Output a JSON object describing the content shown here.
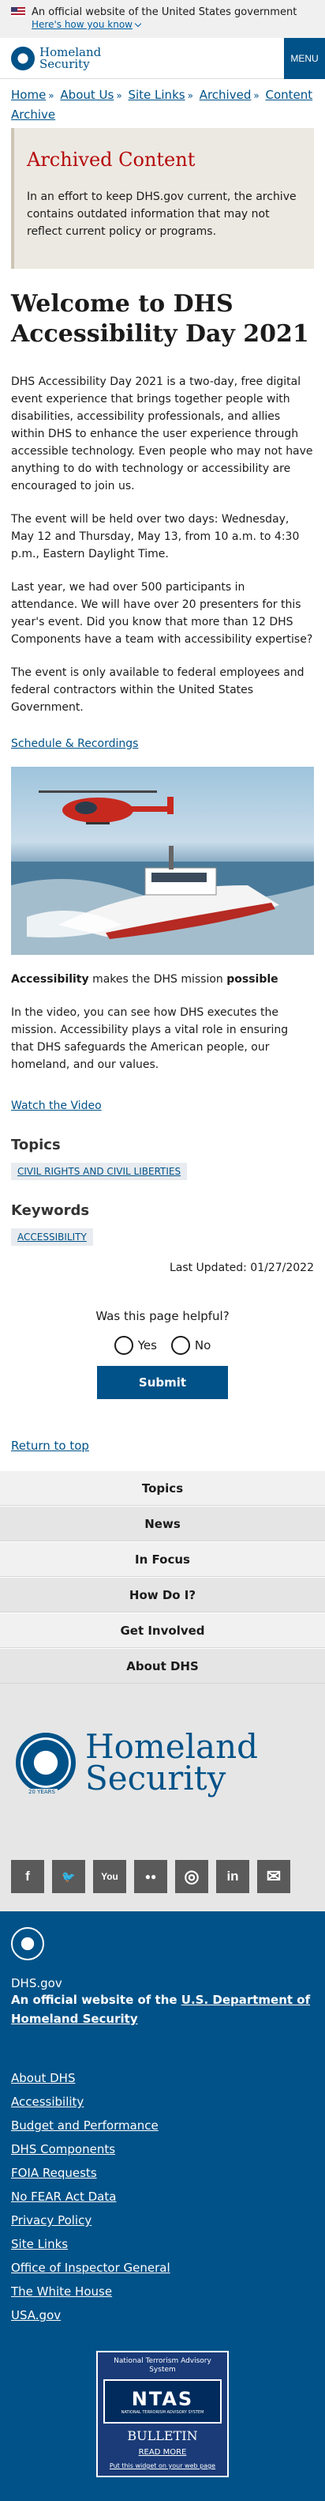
{
  "gov_banner": {
    "text": "An official website of the United States government",
    "how_link": "Here's how you know"
  },
  "header": {
    "logo_line1": "Homeland",
    "logo_line2": "Security",
    "menu_label": "MENU"
  },
  "breadcrumb": {
    "items": [
      "Home",
      "About Us",
      "Site Links",
      "Archived",
      "Content Archive"
    ]
  },
  "archived": {
    "title": "Archived Content",
    "body": "In an effort to keep DHS.gov current, the archive contains outdated information that may not reflect current policy or programs."
  },
  "page_title": "Welcome to DHS Accessibility Day 2021",
  "body": {
    "p1": "DHS Accessibility Day 2021 is a two-day, free digital event experience that brings together people with disabilities, accessibility professionals, and allies within DHS to enhance the user experience through accessible technology. Even people who may not have anything to do with technology or accessibility are encouraged to join us.",
    "p2": "The event will be held over two days: Wednesday, May 12 and Thursday, May 13, from 10 a.m. to 4:30 p.m., Eastern Daylight Time.",
    "p3": "Last year, we had over 500 participants in attendance. We will have over 20 presenters for this year's event. Did you know that more than 12 DHS Components have a team with accessibility expertise?",
    "p4": "The event is only available to federal employees and federal contractors within the United States Government.",
    "schedule_link": "Schedule & Recordings",
    "caption_bold1": "Accessibility",
    "caption_mid": " makes the DHS mission ",
    "caption_bold2": "possible",
    "p5": "In the video, you can see how DHS executes the mission. Accessibility plays a vital role in ensuring that DHS safeguards the American people, our homeland, and our values.",
    "video_link": "Watch the Video"
  },
  "topics": {
    "label": "Topics",
    "tag": "CIVIL RIGHTS AND CIVIL LIBERTIES"
  },
  "keywords": {
    "label": "Keywords",
    "tag": "ACCESSIBILITY"
  },
  "last_updated": "Last Updated: 01/27/2022",
  "feedback": {
    "question": "Was this page helpful?",
    "yes": "Yes",
    "no": "No",
    "submit": "Submit"
  },
  "return_top": "Return to top",
  "footer_nav": [
    "Topics",
    "News",
    "In Focus",
    "How Do I?",
    "Get Involved",
    "About DHS"
  ],
  "footer_logo": {
    "line1": "Homeland",
    "line2": "Security",
    "years": "20 YEARS"
  },
  "social": [
    {
      "icon": "facebook-icon",
      "glyph": "f"
    },
    {
      "icon": "twitter-icon",
      "glyph": "🐦"
    },
    {
      "icon": "youtube-icon",
      "glyph": "You"
    },
    {
      "icon": "flickr-icon",
      "glyph": "●●"
    },
    {
      "icon": "instagram-icon",
      "glyph": "◎"
    },
    {
      "icon": "linkedin-icon",
      "glyph": "in"
    },
    {
      "icon": "email-icon",
      "glyph": "✉"
    }
  ],
  "footer": {
    "domain": "DHS.gov",
    "official_prefix": "An official website of the ",
    "official_link": "U.S. Department of Homeland Security",
    "links": [
      "About DHS",
      "Accessibility",
      "Budget and Performance",
      "DHS Components",
      "FOIA Requests",
      "No FEAR Act Data",
      "Privacy Policy",
      "Site Links",
      "Office of Inspector General",
      "The White House",
      "USA.gov"
    ]
  },
  "ntas": {
    "top": "National Terrorism Advisory System",
    "big": "NTAS",
    "sub": "NATIONAL TERRORISM ADVISORY SYSTEM",
    "bulletin": "BULLETIN",
    "readmore": "READ MORE",
    "widget": "Put this widget on your web page"
  },
  "colors": {
    "brand_blue": "#005288",
    "archived_red": "#b50909",
    "archived_bg": "#ece9e2"
  }
}
